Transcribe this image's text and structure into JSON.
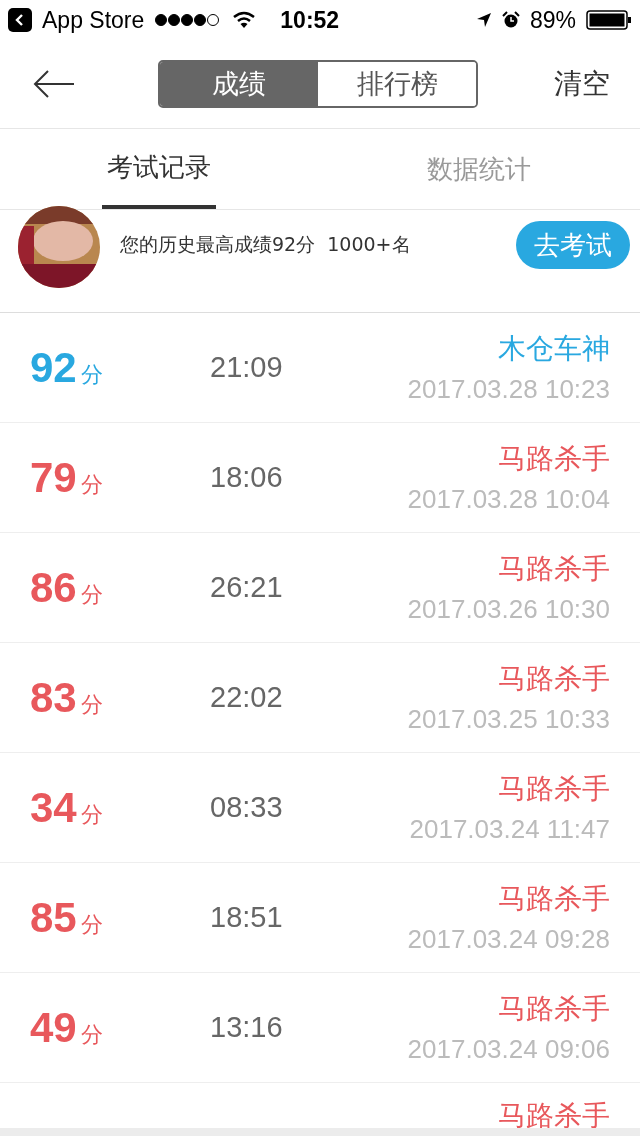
{
  "status_bar": {
    "back_app": "App Store",
    "time": "10:52",
    "battery": "89%"
  },
  "nav": {
    "segments": [
      {
        "label": "成绩",
        "selected": true
      },
      {
        "label": "排行榜",
        "selected": false
      }
    ],
    "action": "清空"
  },
  "tabs": [
    {
      "label": "考试记录",
      "selected": true
    },
    {
      "label": "数据统计",
      "selected": false
    }
  ],
  "summary": {
    "text": "您的历史最高成绩92分  1000+名",
    "button": "去考试"
  },
  "records": [
    {
      "score": "92",
      "unit": "分",
      "duration": "21:09",
      "title": "木仓车神",
      "date": "2017.03.28 10:23",
      "color": "#29a8e0"
    },
    {
      "score": "79",
      "unit": "分",
      "duration": "18:06",
      "title": "马路杀手",
      "date": "2017.03.28 10:04",
      "color": "#e8585c"
    },
    {
      "score": "86",
      "unit": "分",
      "duration": "26:21",
      "title": "马路杀手",
      "date": "2017.03.26 10:30",
      "color": "#e8585c"
    },
    {
      "score": "83",
      "unit": "分",
      "duration": "22:02",
      "title": "马路杀手",
      "date": "2017.03.25 10:33",
      "color": "#e8585c"
    },
    {
      "score": "34",
      "unit": "分",
      "duration": "08:33",
      "title": "马路杀手",
      "date": "2017.03.24 11:47",
      "color": "#e8585c"
    },
    {
      "score": "85",
      "unit": "分",
      "duration": "18:51",
      "title": "马路杀手",
      "date": "2017.03.24 09:28",
      "color": "#e8585c"
    },
    {
      "score": "49",
      "unit": "分",
      "duration": "13:16",
      "title": "马路杀手",
      "date": "2017.03.24 09:06",
      "color": "#e8585c"
    },
    {
      "title": "马路杀手",
      "color": "#e8585c"
    }
  ]
}
